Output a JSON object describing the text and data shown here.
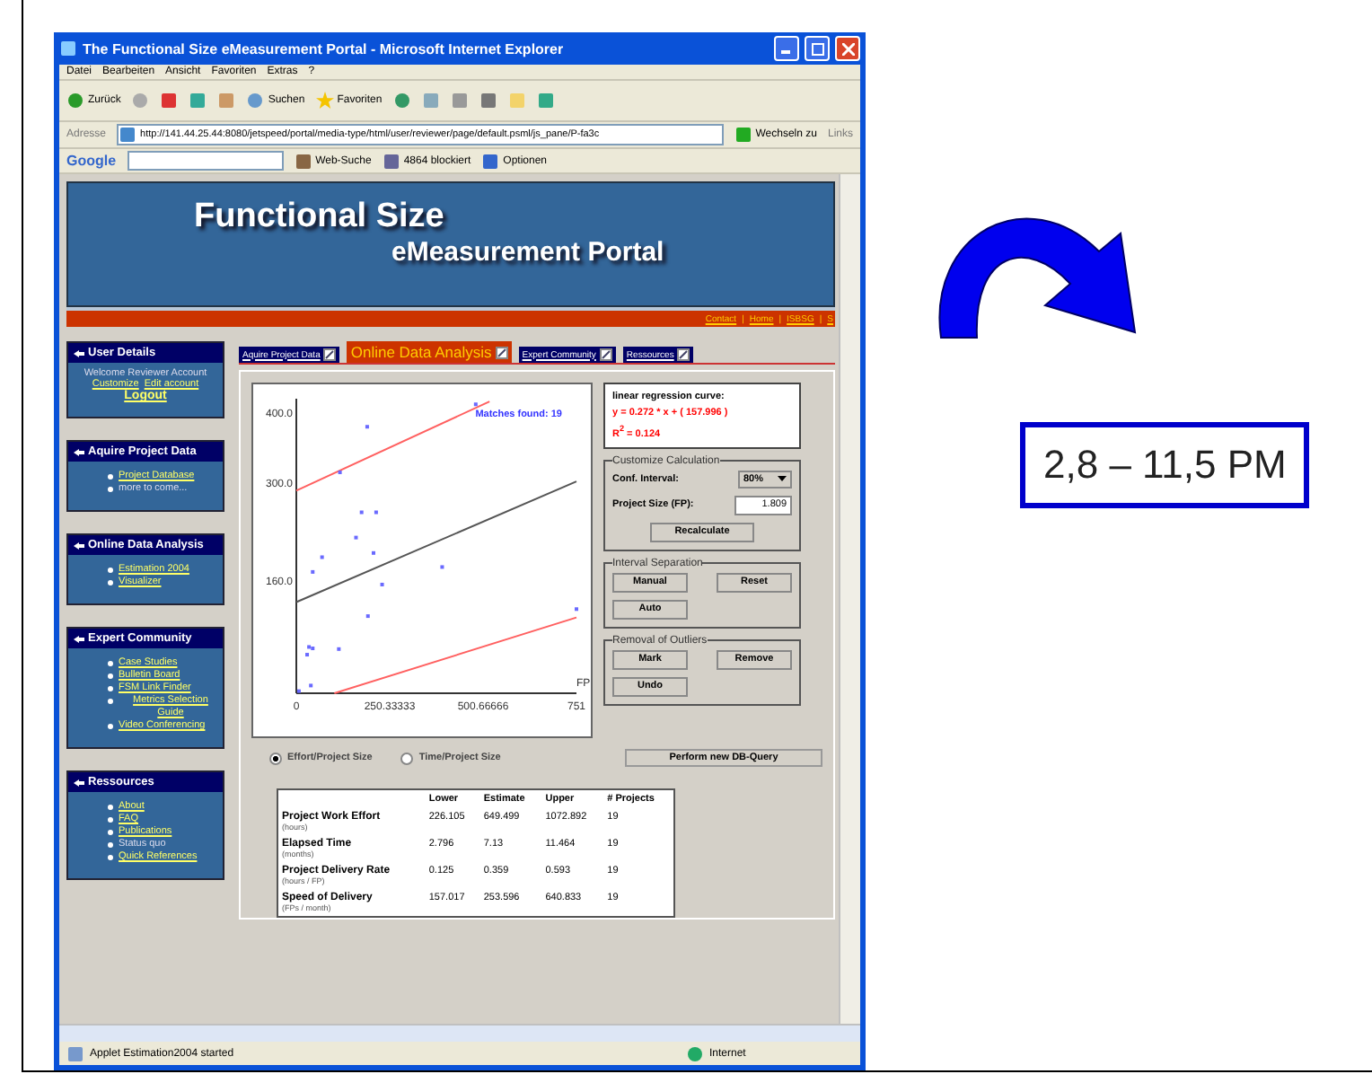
{
  "window": {
    "title": "The Functional Size eMeasurement Portal - Microsoft Internet Explorer"
  },
  "menu": [
    "Datei",
    "Bearbeiten",
    "Ansicht",
    "Favoriten",
    "Extras",
    "?"
  ],
  "toolbar": {
    "back": "Zurück",
    "search": "Suchen",
    "favorites": "Favoriten"
  },
  "address": {
    "label": "Adresse",
    "url": "http://141.44.25.44:8080/jetspeed/portal/media-type/html/user/reviewer/page/default.psml/js_pane/P-fa3c",
    "go": "Wechseln zu",
    "links": "Links"
  },
  "google_bar": {
    "logo": "Google",
    "search": "Web-Suche",
    "blocked": "4864 blockiert",
    "options": "Optionen"
  },
  "banner": {
    "title": "Functional Size",
    "subtitle": "eMeasurement Portal",
    "links": [
      "Contact",
      "Home",
      "ISBSG",
      "S"
    ],
    "separator": "|"
  },
  "sidebar": [
    {
      "title": "User Details",
      "intro": "Welcome Reviewer Account",
      "links": [
        "Customize",
        "Edit account"
      ],
      "logout": "Logout"
    },
    {
      "title": "Aquire Project Data",
      "items": [
        {
          "label": "Project Database",
          "kind": "link"
        },
        {
          "label": "more to come...",
          "kind": "plain"
        }
      ]
    },
    {
      "title": "Online Data Analysis",
      "items": [
        {
          "label": "Estimation 2004",
          "kind": "link"
        },
        {
          "label": "Visualizer",
          "kind": "link"
        }
      ]
    },
    {
      "title": "Expert Community",
      "items": [
        {
          "label": "Case Studies",
          "kind": "link"
        },
        {
          "label": "Bulletin Board",
          "kind": "link"
        },
        {
          "label": "FSM Link Finder",
          "kind": "link"
        },
        {
          "label": "Metrics Selection Guide",
          "kind": "link"
        },
        {
          "label": "Video Conferencing",
          "kind": "link"
        }
      ]
    },
    {
      "title": "Ressources",
      "items": [
        {
          "label": "About",
          "kind": "link"
        },
        {
          "label": "FAQ",
          "kind": "link"
        },
        {
          "label": "Publications",
          "kind": "link"
        },
        {
          "label": "Status quo",
          "kind": "plain"
        },
        {
          "label": "Quick References",
          "kind": "link"
        }
      ]
    }
  ],
  "tabs": [
    {
      "label": "Aquire Project Data",
      "selected": false
    },
    {
      "label": "Online Data Analysis",
      "selected": true
    },
    {
      "label": "Expert Community",
      "selected": false
    },
    {
      "label": "Ressources",
      "selected": false
    }
  ],
  "chart": {
    "chart_data": {
      "type": "scatter",
      "xlabel": "FP",
      "xlim": [
        0,
        751
      ],
      "ylim": [
        0,
        420
      ],
      "xticks": [
        0,
        {
          "value": 250.33333,
          "label": "250.33333"
        },
        {
          "value": 500.66666,
          "label": "500.66666"
        },
        751
      ],
      "yticks": [
        {
          "value": 160,
          "label": "160.0"
        },
        {
          "value": 300,
          "label": "300.0"
        },
        {
          "value": 400,
          "label": "400.0"
        }
      ],
      "annotations": [
        "Matches found: 19"
      ],
      "series": [
        {
          "type": "line",
          "color": "#555555",
          "x": [
            0,
            751
          ],
          "values": [
            130,
            302
          ]
        },
        {
          "type": "line",
          "color": "#ff6060",
          "x": [
            0,
            518
          ],
          "values": [
            289,
            416
          ]
        },
        {
          "type": "line",
          "color": "#ff6060",
          "x": [
            102,
            751
          ],
          "values": [
            0,
            108
          ]
        },
        {
          "color": "#6a6aff",
          "x": [
            481,
            190,
            117,
            175,
            214,
            160,
            69,
            44,
            207,
            391,
            230,
            192,
            34,
            44,
            114,
            29,
            39,
            7,
            751
          ],
          "values": [
            412,
            380,
            315,
            258,
            258,
            222,
            194,
            173,
            200,
            180,
            155,
            110,
            66,
            64,
            63,
            55,
            11,
            3,
            120
          ]
        }
      ]
    }
  },
  "regression": {
    "title": "linear regression curve:",
    "formula": "y = 0.272 * x + ( 157.996 )",
    "r2": "R$^{2}$ = 0.124"
  },
  "customize": {
    "title": "Customize Calculation",
    "conf_label": "Conf. Interval:",
    "conf_value": "80%",
    "size_label": "Project Size (FP):",
    "size_value": "1.809",
    "button": "Recalculate"
  },
  "separation": {
    "title": "Interval Separation",
    "buttons": [
      "Manual",
      "Reset",
      "Auto"
    ]
  },
  "outliers": {
    "title": "Removal of Outliers",
    "buttons": [
      "Mark",
      "Remove",
      "Undo"
    ]
  },
  "radios": [
    {
      "label": "Effort/Project Size",
      "selected": true
    },
    {
      "label": "Time/Project Size",
      "selected": false
    }
  ],
  "query_button": "Perform new DB-Query",
  "table": {
    "columns": [
      "Lower",
      "Estimate",
      "Upper",
      "# Projects"
    ],
    "rows": [
      {
        "name": "Project Work Effort",
        "unit": "(hours)",
        "values": [
          "226.105",
          "649.499",
          "1072.892",
          "19"
        ]
      },
      {
        "name": "Elapsed Time",
        "unit": "(months)",
        "values": [
          "2.796",
          "7.13",
          "11.464",
          "19"
        ]
      },
      {
        "name": "Project Delivery Rate",
        "unit": "(hours / FP)",
        "values": [
          "0.125",
          "0.359",
          "0.593",
          "19"
        ]
      },
      {
        "name": "Speed of Delivery",
        "unit": "(FPs / month)",
        "values": [
          "157.017",
          "253.596",
          "640.833",
          "19"
        ]
      }
    ]
  },
  "status_bar": {
    "message": "Applet Estimation2004 started",
    "zone": "Internet"
  },
  "callout": "2,8 – 11,5 PM"
}
